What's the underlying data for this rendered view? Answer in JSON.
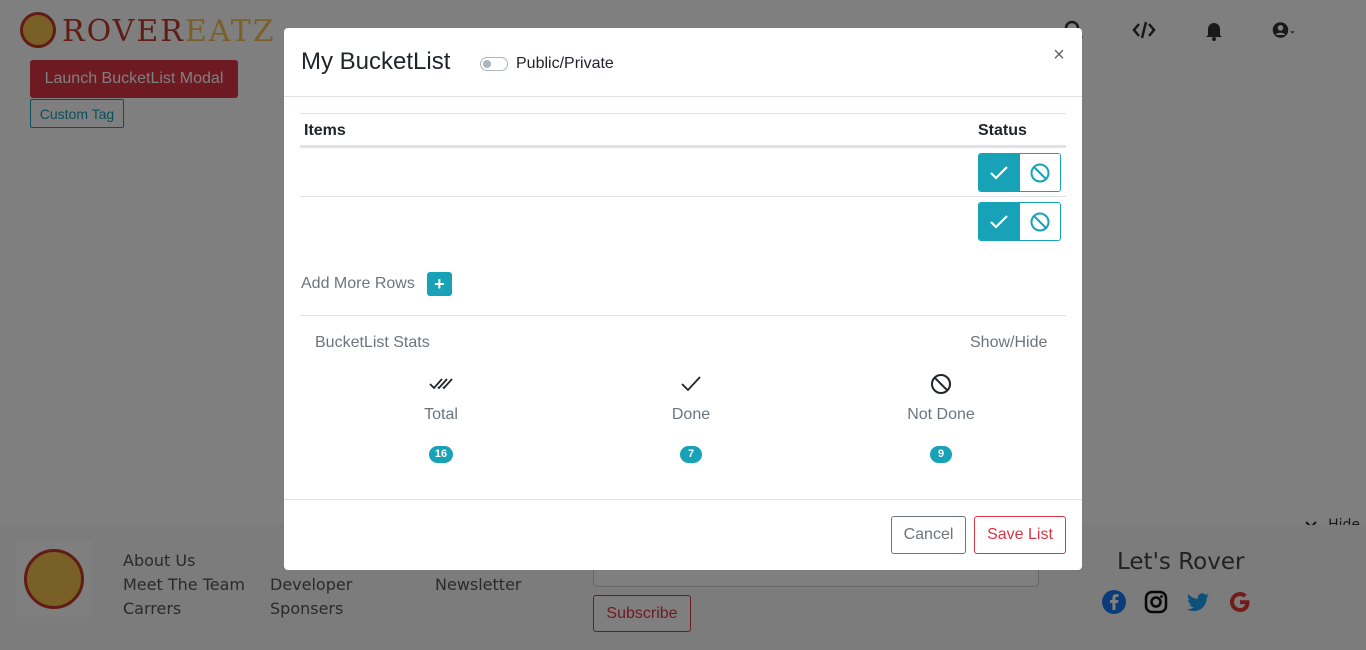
{
  "brand": {
    "logo_text_main": "ROVER",
    "logo_text_accent": "EATZ",
    "colors": {
      "red": "#dc3545",
      "teal": "#17a2b8",
      "yellow": "#f2c14e"
    }
  },
  "header": {
    "icons": [
      "search-icon",
      "code-icon",
      "bell-icon",
      "user-account-icon"
    ]
  },
  "page": {
    "launch_button": "Launch BucketList Modal",
    "custom_tag_button": "Custom Tag"
  },
  "footer": {
    "col1": [
      "About Us",
      "Meet The Team",
      "Carrers"
    ],
    "col2": [
      "Developer",
      "Sponsers"
    ],
    "col3": [
      "Newsletter"
    ],
    "subscribe_button": "Subscribe",
    "lets_rover": "Let's Rover",
    "social_icons": [
      "facebook-icon",
      "instagram-icon",
      "twitter-icon",
      "google-icon"
    ],
    "hide_label": "Hide"
  },
  "modal": {
    "title": "My BucketList",
    "visibility_label": "Public/Private",
    "visibility_public": false,
    "close_symbol": "×",
    "table": {
      "headers": {
        "items": "Items",
        "status": "Status"
      },
      "rows": [
        {
          "item": "",
          "status": "done"
        },
        {
          "item": "",
          "status": "done"
        }
      ]
    },
    "add_rows_label": "Add More Rows",
    "add_rows_symbol": "+",
    "stats": {
      "title": "BucketList Stats",
      "toggle_label": "Show/Hide",
      "items": [
        {
          "label": "Total",
          "value": "16",
          "icon": "double-check-icon"
        },
        {
          "label": "Done",
          "value": "7",
          "icon": "check-icon"
        },
        {
          "label": "Not Done",
          "value": "9",
          "icon": "ban-icon"
        }
      ]
    },
    "buttons": {
      "cancel": "Cancel",
      "save": "Save List"
    }
  }
}
